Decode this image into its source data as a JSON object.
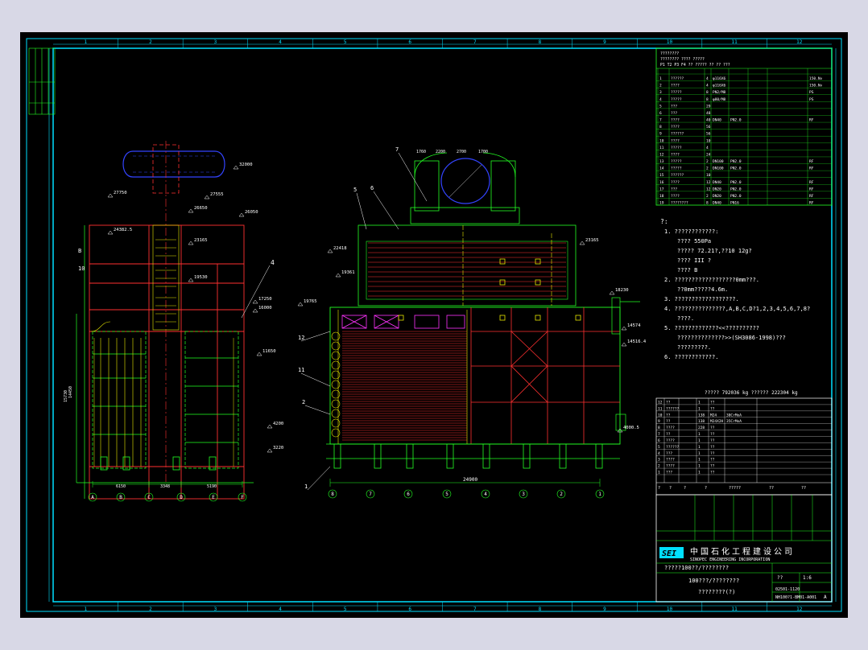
{
  "colors": {
    "background": "#000000",
    "border": "#00e0ff",
    "line_green": "#22ff22",
    "line_red": "#ff3030",
    "line_yellow": "#e8e800",
    "line_blue": "#3344ff",
    "line_magenta": "#ff33ff",
    "text_white": "#ffffff",
    "outer_bg": "#d8d8e6"
  },
  "grid": {
    "top_numbers": [
      "1",
      "2",
      "3",
      "4",
      "5",
      "6",
      "7",
      "8",
      "9",
      "10",
      "11",
      "12"
    ],
    "bottom_numbers": [
      "1",
      "2",
      "3",
      "4",
      "5",
      "6",
      "7",
      "8",
      "9",
      "10",
      "11",
      "12"
    ]
  },
  "left_view": {
    "elevations": [
      "32000",
      "27750",
      "27555",
      "26650",
      "26050",
      "24382.5",
      "23165",
      "19530",
      "17250",
      "16000",
      "11650",
      "4200",
      "3220"
    ],
    "top_dims": [
      "6150",
      "3348",
      "5190"
    ],
    "axis_labels": [
      "A",
      "B",
      "C",
      "D",
      "E",
      "F"
    ],
    "callout": "4",
    "left_dims": [
      "B",
      "10",
      "14450",
      "15730"
    ]
  },
  "front_view": {
    "top_dims": [
      "1760",
      "2200",
      "2700",
      "1700"
    ],
    "elevations": [
      "22418",
      "19361",
      "19765",
      "23165",
      "18230",
      "14574",
      "14516.4",
      "4000.5"
    ],
    "callouts": [
      "7",
      "5",
      "6",
      "12",
      "11",
      "2",
      "1"
    ],
    "bottom_dims": [
      "24900"
    ],
    "axis_labels": [
      "8",
      "7",
      "6",
      "5",
      "4",
      "3",
      "2",
      "1"
    ]
  },
  "notes": {
    "heading": "?:",
    "lines": [
      "1.  ????????????:",
      "????                550Pa",
      "?????              72.21?,??10 12g?",
      "????                III  ?",
      "????                B",
      "2.  ??????????????????0mm???.",
      "??0mm?????4.6m.",
      "3.  ??????????????????.",
      "4.  ???????????????,A,B,C,D?1,2,3,4,5,6,7,8?",
      "????.",
      "5.  ?????????????<<??????????",
      "??????????????>>(SH3086-1998)???",
      "?????????.",
      "6.  ????????????."
    ],
    "weight_line": "?????   792036  kg          ??????   222304  kg"
  },
  "parts_table_top": {
    "header_rows": [
      "????????",
      "???????? ???? ?????",
      "P1 T2 P3 F4 ?? ????? ?? ?? ???"
    ],
    "rows": [
      [
        "1",
        "??????",
        "4",
        "φ116X6",
        "",
        "",
        "150.Nv"
      ],
      [
        "2",
        "????",
        "4",
        "φ116X6",
        "",
        "",
        "150.Nv"
      ],
      [
        "3",
        "?????",
        "8",
        "PN2/M8",
        "",
        "",
        "PS"
      ],
      [
        "4",
        "?????",
        "8",
        "φ80/M8",
        "",
        "",
        "PS"
      ],
      [
        "5",
        "???",
        "29",
        "",
        "",
        "",
        ""
      ],
      [
        "6",
        "???",
        "48",
        "",
        "",
        "",
        ""
      ],
      [
        "7",
        "????",
        "40",
        "DN40",
        "PN2.0",
        "",
        "RF"
      ],
      [
        "8",
        "????",
        "56",
        "",
        "",
        "",
        ""
      ],
      [
        "9",
        "??????",
        "56",
        "",
        "",
        "",
        ""
      ],
      [
        "10",
        "????",
        "10",
        "",
        "",
        "",
        ""
      ],
      [
        "11",
        "?????",
        "4",
        "",
        "",
        "",
        ""
      ],
      [
        "12",
        "????",
        "24",
        "",
        "",
        "",
        ""
      ],
      [
        "13",
        "?????",
        "2",
        "DN100",
        "PN2.0",
        "",
        "RF"
      ],
      [
        "14",
        "?????",
        "2",
        "DN100",
        "PN2.0",
        "",
        "RF"
      ],
      [
        "15",
        "??????",
        "10",
        "",
        "",
        "",
        ""
      ],
      [
        "16",
        "????",
        "12",
        "DN40",
        "PN2.0",
        "",
        "RF"
      ],
      [
        "17",
        "???",
        "12",
        "DN20",
        "PN2.0",
        "",
        "RF"
      ],
      [
        "18",
        "????",
        "2",
        "DN20",
        "PN2.0",
        "",
        "RF"
      ],
      [
        "19",
        "????????",
        "8",
        "DN40",
        "PN16",
        "",
        "RF"
      ]
    ]
  },
  "parts_table_bottom": {
    "rows": [
      [
        "12",
        "??",
        "1",
        "??",
        ""
      ],
      [
        "11",
        "??????",
        "1",
        "??",
        ""
      ],
      [
        "10",
        "??",
        "138",
        "M24",
        "30CrMoA"
      ],
      [
        "9",
        "??",
        "138",
        "M24X2H",
        "35CrMoA"
      ],
      [
        "8",
        "????",
        "228",
        "??",
        ""
      ],
      [
        "7",
        "??",
        "1",
        "??",
        ""
      ],
      [
        "6",
        "????",
        "1",
        "??",
        ""
      ],
      [
        "5",
        "??????",
        "1",
        "??",
        ""
      ],
      [
        "4",
        "???",
        "1",
        "??",
        ""
      ],
      [
        "3",
        "????",
        "1",
        "??",
        ""
      ],
      [
        "2",
        "????",
        "1",
        "??",
        ""
      ],
      [
        "1",
        "???",
        "1",
        "??",
        ""
      ]
    ],
    "header": [
      "?",
      "?",
      "?",
      "?",
      "?????",
      "??",
      "??"
    ]
  },
  "title_block": {
    "company_cn": "中国石化工程建设公司",
    "company_en": "SINOPEC ENGINEERING INCORPORATION",
    "logo": "SEI",
    "project_line": "?????100??/????????",
    "title_line1": "100???/????????",
    "title_line2": "????????(?)",
    "drawing_no": "02501-1120",
    "drawing_no2": "NH100?1-BM01-A001",
    "scale": "1:6",
    "sheet": "??",
    "rev": "A"
  }
}
